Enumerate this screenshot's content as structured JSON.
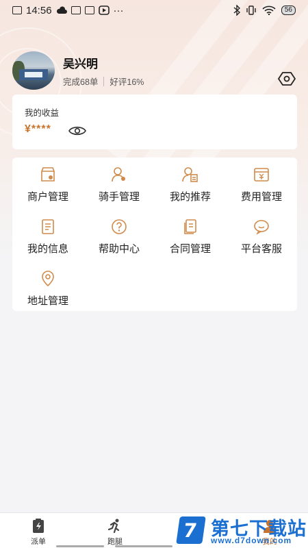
{
  "status_bar": {
    "time": "14:56",
    "more": "···",
    "battery": "56"
  },
  "profile": {
    "name": "吴兴明",
    "completed": "完成68单",
    "rating": "好评16%"
  },
  "income": {
    "title": "我的收益",
    "value": "¥****"
  },
  "menu": [
    {
      "label": "商户管理",
      "icon": "shop-icon"
    },
    {
      "label": "骑手管理",
      "icon": "rider-icon"
    },
    {
      "label": "我的推荐",
      "icon": "referral-icon"
    },
    {
      "label": "费用管理",
      "icon": "fee-icon"
    },
    {
      "label": "我的信息",
      "icon": "info-icon"
    },
    {
      "label": "帮助中心",
      "icon": "help-icon"
    },
    {
      "label": "合同管理",
      "icon": "contract-icon"
    },
    {
      "label": "平台客服",
      "icon": "chat-icon"
    },
    {
      "label": "地址管理",
      "icon": "location-icon"
    }
  ],
  "tabs": [
    {
      "label": "派单",
      "icon": "dispatch-icon"
    },
    {
      "label": "跑腿",
      "icon": "runner-icon"
    },
    {
      "label": "",
      "icon": "hidden-icon"
    },
    {
      "label": "我的",
      "icon": "profile-icon"
    }
  ],
  "watermark": {
    "logo": "7",
    "title": "第七下载站",
    "url": "www.d7down.com"
  },
  "colors": {
    "accent": "#c9742e",
    "icon_stroke": "#d08a4a",
    "watermark": "#1a6fd1"
  }
}
